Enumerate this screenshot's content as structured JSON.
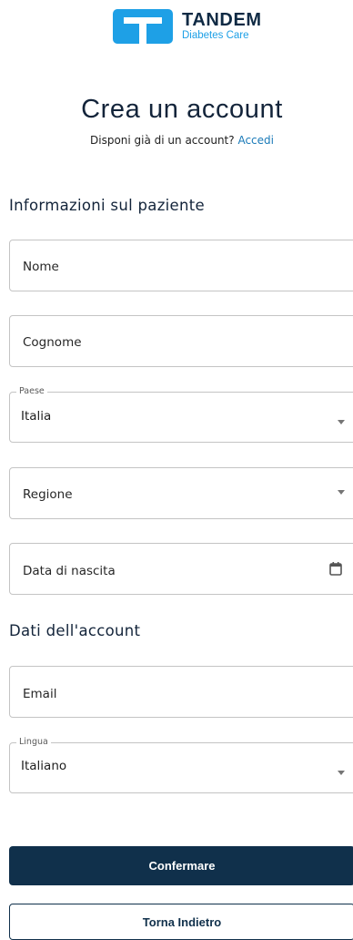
{
  "brand": {
    "name": "TANDEM",
    "tagline": "Diabetes Care",
    "color": "#1ea0e6"
  },
  "header": {
    "title": "Crea un account",
    "signin_prompt": "Disponi già di un account?",
    "signin_link": "Accedi"
  },
  "patient_section": {
    "title": "Informazioni sul paziente",
    "first_name": {
      "placeholder": "Nome"
    },
    "last_name": {
      "placeholder": "Cognome"
    },
    "country": {
      "label": "Paese",
      "value": "Italia"
    },
    "region": {
      "placeholder": "Regione"
    },
    "birth_date": {
      "placeholder": "Data di nascita",
      "icon": "calendar-icon"
    }
  },
  "account_section": {
    "title": "Dati dell'account",
    "email": {
      "placeholder": "Email"
    },
    "language": {
      "label": "Lingua",
      "value": "Italiano"
    }
  },
  "actions": {
    "confirm_label": "Confermare",
    "back_label": "Torna Indietro",
    "primary_color": "#10304b"
  }
}
